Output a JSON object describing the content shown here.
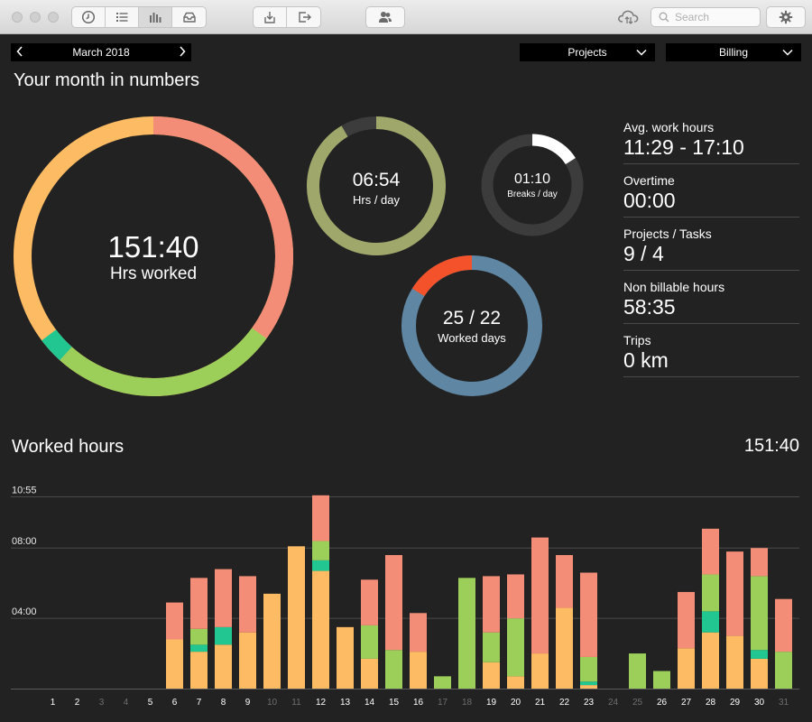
{
  "toolbar": {
    "search_placeholder": "Search",
    "icons": [
      "clock-icon",
      "list-icon",
      "bar-chart-icon",
      "inbox-icon",
      "import-icon",
      "export-icon",
      "users-icon",
      "cloud-sync-icon",
      "gear-icon"
    ]
  },
  "controls": {
    "month": "March 2018",
    "projects_label": "Projects",
    "billing_label": "Billing"
  },
  "summary": {
    "title": "Your month in numbers",
    "hours_worked": {
      "value": "151:40",
      "label": "Hrs worked"
    },
    "hrs_per_day": {
      "value": "06:54",
      "label": "Hrs / day"
    },
    "breaks": {
      "value": "01:10",
      "label": "Breaks / day"
    },
    "worked_days": {
      "value": "25 / 22",
      "label": "Worked days"
    }
  },
  "stats": [
    {
      "label": "Avg. work hours",
      "value": "11:29 - 17:10"
    },
    {
      "label": "Overtime",
      "value": "00:00"
    },
    {
      "label": "Projects / Tasks",
      "value": "9 / 4"
    },
    {
      "label": "Non billable hours",
      "value": "58:35"
    },
    {
      "label": "Trips",
      "value": "0 km"
    }
  ],
  "colors": {
    "orange": "#fdbb63",
    "salmon": "#f38d77",
    "green": "#9ccf5a",
    "teal": "#21c690",
    "olive": "#a0a76a",
    "steel": "#5f87a4",
    "red": "#f4522a",
    "dark_ring": "#3c3c3c"
  },
  "chart_data": {
    "type": "bar",
    "title": "Worked hours",
    "total": "151:40",
    "y_tick_labels": [
      "10:55",
      "08:00",
      "04:00"
    ],
    "y_ticks_hours": [
      10.9167,
      8,
      4
    ],
    "ylim": [
      0,
      11.3
    ],
    "categories": [
      "1",
      "2",
      "3",
      "4",
      "5",
      "6",
      "7",
      "8",
      "9",
      "10",
      "11",
      "12",
      "13",
      "14",
      "15",
      "16",
      "17",
      "18",
      "19",
      "20",
      "21",
      "22",
      "23",
      "24",
      "25",
      "26",
      "27",
      "28",
      "29",
      "30",
      "31"
    ],
    "weekend_days": [
      "3",
      "4",
      "10",
      "11",
      "17",
      "18",
      "24",
      "25",
      "31"
    ],
    "series": [
      {
        "color": "orange",
        "values": [
          0,
          0,
          0,
          0,
          0,
          2.8,
          2.1,
          2.5,
          3.2,
          5.4,
          8.1,
          6.7,
          3.5,
          1.7,
          0,
          2.1,
          0,
          0,
          1.5,
          0.7,
          2,
          4.6,
          0.2,
          0,
          0,
          0,
          2.3,
          3.2,
          3.0,
          1.7,
          0
        ]
      },
      {
        "color": "teal",
        "values": [
          0,
          0,
          0,
          0,
          0,
          0,
          0.4,
          1.0,
          0,
          0,
          0,
          0.6,
          0,
          0,
          0,
          0,
          0,
          0,
          0,
          0,
          0,
          0,
          0.2,
          0,
          0,
          0,
          0,
          1.2,
          0,
          0.5,
          0
        ]
      },
      {
        "color": "green",
        "values": [
          0,
          0,
          0,
          0,
          0,
          0,
          0.9,
          0,
          0,
          0,
          0,
          1.1,
          0,
          1.9,
          2.2,
          0,
          0.7,
          6.3,
          1.7,
          3.3,
          0,
          0,
          1.4,
          0,
          2.0,
          1.0,
          0,
          2.1,
          0,
          4.2,
          2.1
        ]
      },
      {
        "color": "salmon",
        "values": [
          0,
          0,
          0,
          0,
          0,
          2.1,
          2.9,
          3.3,
          3.2,
          0,
          0,
          2.6,
          0,
          2.6,
          5.4,
          2.2,
          0,
          0,
          3.2,
          2.5,
          6.6,
          3.0,
          4.8,
          0,
          0,
          0,
          3.2,
          2.6,
          4.8,
          1.6,
          3.0
        ]
      }
    ]
  }
}
